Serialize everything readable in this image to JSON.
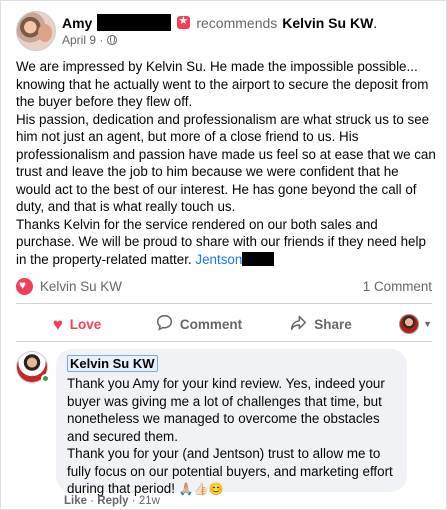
{
  "header": {
    "author_first": "Amy",
    "recommends_text": "recommends",
    "page_name": "Kelvin Su KW",
    "page_name_suffix": ".",
    "date": "April 9 ·",
    "more_label": "···"
  },
  "post": {
    "paragraphs": [
      "We are impressed by Kelvin Su. He made the impossible possible... knowing that he actually went to the airport to secure the deposit from the buyer before they flew off.",
      "His passion, dedication and professionalism are what struck us to see him not just an agent, but more of a close friend to us. His professionalism and passion have made us feel so at ease that we can trust and leave the job to him because we were confident that he would act to the best of our interest. He has gone beyond the call of duty, and that is what really touch us."
    ],
    "closing": "Thanks Kelvin for the service rendered on our both sales and purchase. We will be proud to share with our friends if they need help in the property-related matter.",
    "tag": "Jentson"
  },
  "stats": {
    "reactor": "Kelvin Su KW",
    "comment_count": "1 Comment"
  },
  "actions": {
    "love": "Love",
    "comment": "Comment",
    "share": "Share"
  },
  "comment": {
    "author": "Kelvin Su KW",
    "text_1": "Thank you Amy for your kind review. Yes, indeed your buyer was giving me a lot of challenges that time, but nonetheless we managed to overcome the obstacles and secured them.",
    "text_2": "Thank you for your (and Jentson) trust to allow me to fully focus on our potential buyers, and marketing effort during that period!",
    "emojis": "🙏🏼👍🏻😊",
    "like": "Like",
    "sep": "·",
    "reply": "Reply",
    "time": "21w"
  },
  "colors": {
    "love": "#f33e58",
    "link": "#1877f2",
    "muted": "#65676b",
    "bubble": "#f0f2f5"
  }
}
